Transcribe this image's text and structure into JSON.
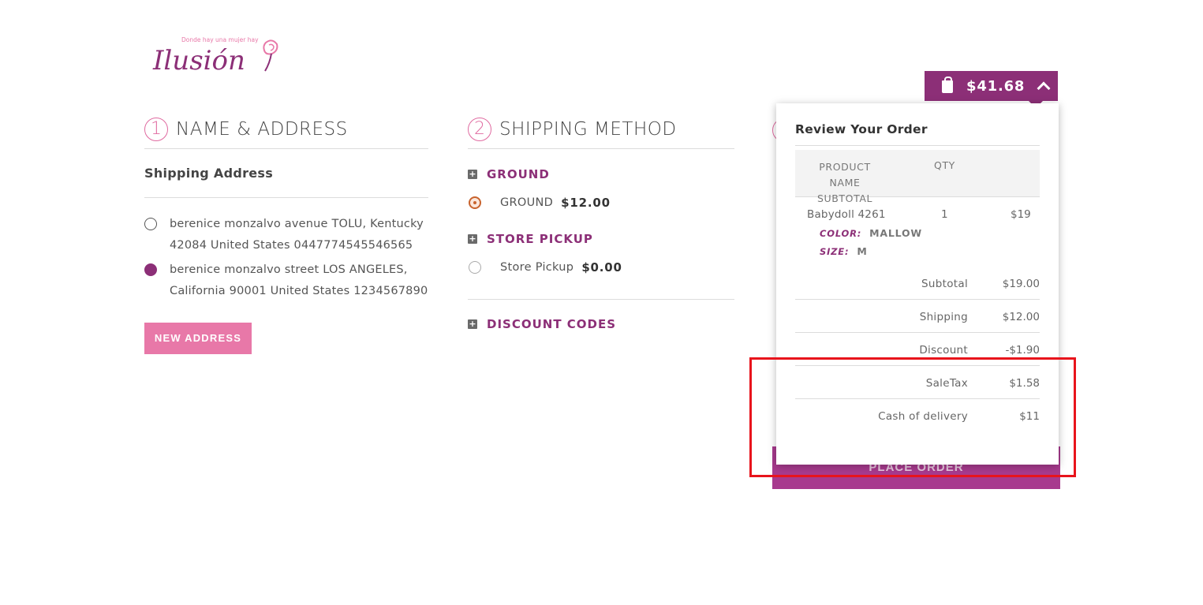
{
  "brand": {
    "tagline": "Donde hay una mujer hay",
    "name": "Ilusión",
    "color": "#8c2f77",
    "accent": "#e878a8"
  },
  "steps": [
    {
      "number": "1",
      "title": "NAME & ADDRESS"
    },
    {
      "number": "2",
      "title": "SHIPPING METHOD"
    }
  ],
  "address": {
    "section_title": "Shipping Address",
    "options": [
      {
        "text": "berenice monzalvo avenue TOLU, Kentucky 42084 United States 0447774545546565",
        "selected": false
      },
      {
        "text": "berenice monzalvo street LOS ANGELES, California 90001 United States 1234567890",
        "selected": true
      }
    ],
    "new_button": "NEW ADDRESS"
  },
  "shipping": {
    "groups": [
      {
        "label": "GROUND",
        "option": {
          "name": "GROUND",
          "price": "$12.00",
          "selected": true
        }
      },
      {
        "label": "STORE PICKUP",
        "option": {
          "name": "Store Pickup",
          "price": "$0.00",
          "selected": false
        }
      }
    ],
    "discount_label": "DISCOUNT CODES",
    "expand_glyph": "+"
  },
  "cart": {
    "total": "$41.68",
    "icon": "shopping-bag-icon"
  },
  "review": {
    "title": "Review Your Order",
    "headers": {
      "product": "PRODUCT NAME SUBTOTAL",
      "qty": "QTY"
    },
    "item": {
      "name": "Babydoll 4261",
      "qty": "1",
      "price": "$19",
      "attributes": [
        {
          "key": "COLOR:",
          "value": "MALLOW"
        },
        {
          "key": "SIZE:",
          "value": "M"
        }
      ]
    },
    "summary": [
      {
        "label": "Subtotal",
        "value": "$19.00"
      },
      {
        "label": "Shipping",
        "value": "$12.00"
      },
      {
        "label": "Discount",
        "value": "-$1.90"
      },
      {
        "label": "SaleTax",
        "value": "$1.58"
      },
      {
        "label": "Cash of delivery",
        "value": "$11"
      }
    ]
  },
  "place_order": "PLACE ORDER",
  "highlight_color": "#e8141c"
}
